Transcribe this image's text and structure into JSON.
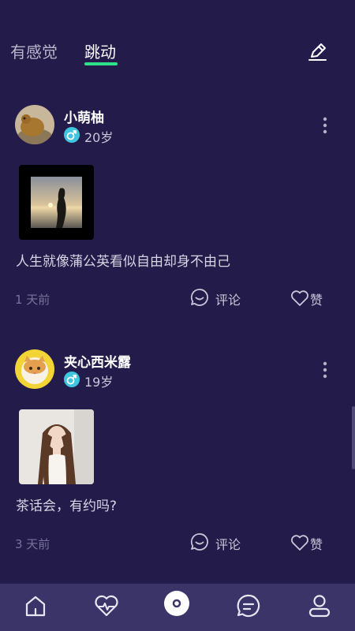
{
  "header": {
    "tabs": [
      {
        "label": "有感觉",
        "active": false
      },
      {
        "label": "跳动",
        "active": true
      }
    ],
    "edit_icon": "pen-icon"
  },
  "posts": [
    {
      "username": "小萌柚",
      "gender": "male",
      "age": "20岁",
      "content": "人生就像蒲公英看似自由却身不由己",
      "time": "1 天前",
      "comment_label": "评论",
      "like_label": "赞"
    },
    {
      "username": "夹心西米露",
      "gender": "male",
      "age": "19岁",
      "content": "茶话会，有约吗?",
      "time": "3 天前",
      "comment_label": "评论",
      "like_label": "赞"
    }
  ],
  "bottom_nav": {
    "items": [
      "home-icon",
      "heart-pulse-icon",
      "disc-icon",
      "chat-icon",
      "user-icon"
    ],
    "active_index": 2
  },
  "colors": {
    "background": "#231c4b",
    "nav_background": "#3b3468",
    "accent": "#2fe08a",
    "gender_badge": "#3ec6e0"
  }
}
